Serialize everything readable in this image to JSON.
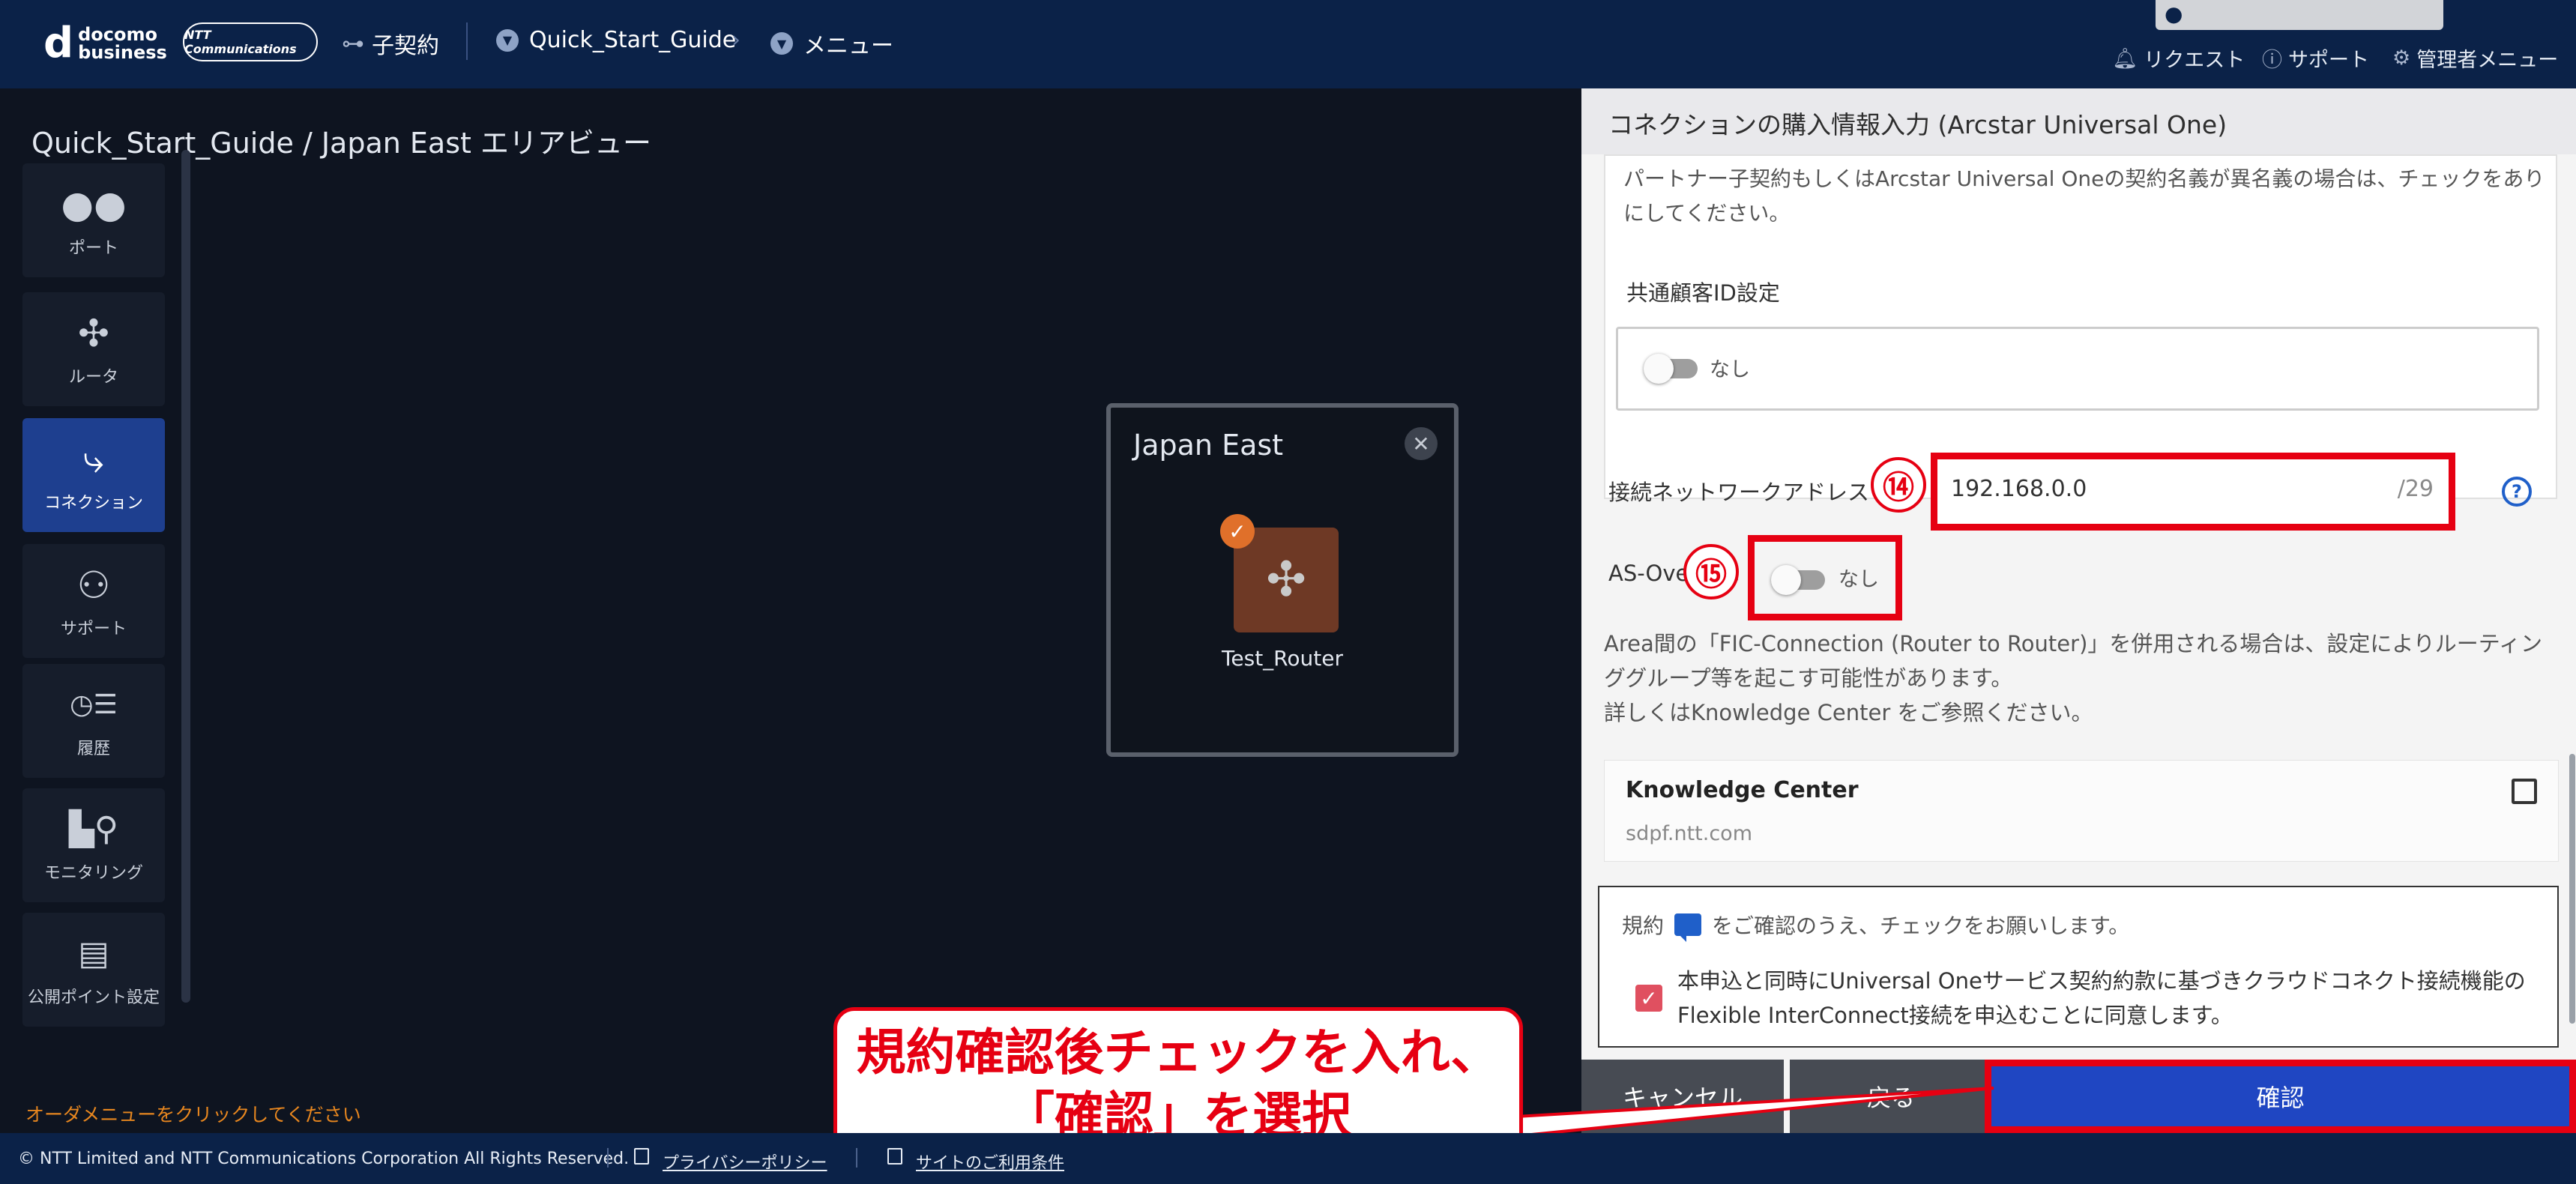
{
  "header": {
    "logo_main": "d",
    "logo_line1": "docomo",
    "logo_line2": "business",
    "ntt_logo": "NTT Communications",
    "sub_contract": "子契約",
    "contract_name": "Quick_Start_Guide",
    "menu": "メニュー",
    "request": "リクエスト",
    "support": "サポート",
    "admin_menu": "管理者メニュー"
  },
  "area": {
    "title": "Quick_Start_Guide / Japan East エリアビュー",
    "order_message": "オーダメニューをクリックしてください"
  },
  "sidebar": {
    "items": [
      {
        "label": "ポート",
        "icon": "port-icon"
      },
      {
        "label": "ルータ",
        "icon": "router-icon"
      },
      {
        "label": "コネクション",
        "icon": "connection-icon"
      },
      {
        "label": "サポート",
        "icon": "support-icon"
      },
      {
        "label": "履歴",
        "icon": "history-icon"
      },
      {
        "label": "モニタリング",
        "icon": "monitoring-icon"
      },
      {
        "label": "公開ポイント設定",
        "icon": "public-point-icon"
      }
    ]
  },
  "popup": {
    "title": "Japan East",
    "router_label": "Test_Router"
  },
  "panel": {
    "title": "コネクションの購入情報入力 (Arcstar Universal One)",
    "partner_note": "パートナー子契約もしくはArcstar Universal Oneの契約名義が異名義の場合は、チェックをありにしてください。",
    "common_customer_id_label": "共通顧客ID設定",
    "common_customer_id_toggle": "なし",
    "network_address_label": "接続ネットワークアドレス",
    "network_address_value": "192.168.0.0",
    "network_address_suffix": "/29",
    "as_override_label": "AS-Override",
    "as_override_toggle": "なし",
    "info_line1": "Area間の「FIC-Connection (Router to Router)」を併用される場合は、設定によりルーティンググループ等を起こす可能性があります。",
    "info_line2": "詳しくはKnowledge Center をご参照ください。",
    "kc_title": "Knowledge Center",
    "kc_url": "sdpf.ntt.com",
    "terms_prefix": "規約",
    "terms_suffix": "をご確認のうえ、チェックをお願いします。",
    "agree_text": "本申込と同時にUniversal Oneサービス契約約款に基づきクラウドコネクト接続機能のFlexible InterConnect接続を申込むことに同意します。",
    "cancel": "キャンセル",
    "back": "戻る",
    "confirm": "確認"
  },
  "annotations": {
    "step14": "⑭",
    "step15": "⑮",
    "callout_line1": "規約確認後チェックを入れ、",
    "callout_line2": "「確認」を選択",
    "highlight_color": "#e60012"
  },
  "footer": {
    "copyright": "© NTT Limited and NTT Communications Corporation All Rights Reserved.",
    "privacy": "プライバシーポリシー",
    "terms_of_use": "サイトのご利用条件"
  }
}
